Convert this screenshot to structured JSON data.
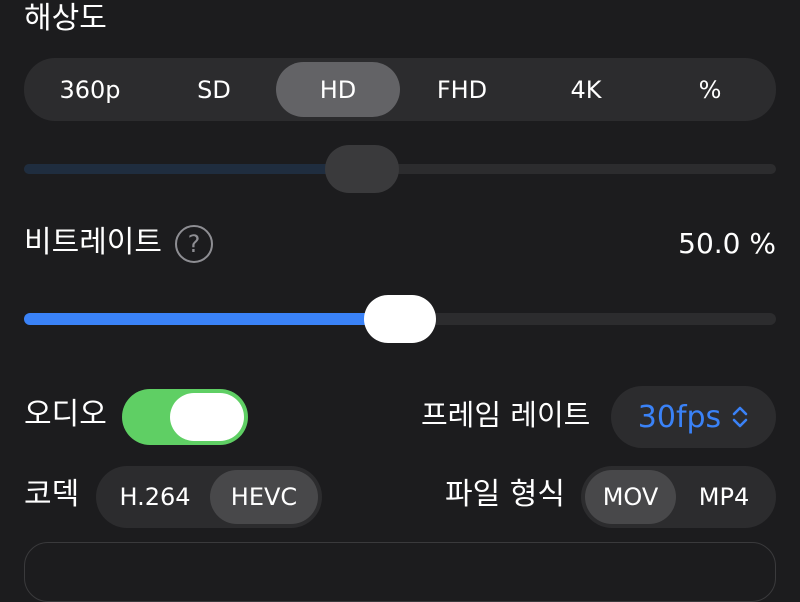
{
  "resolution": {
    "title": "해상도",
    "options": [
      "360p",
      "SD",
      "HD",
      "FHD",
      "4K",
      "%"
    ],
    "selected": "HD",
    "slider_level": 0.45
  },
  "bitrate": {
    "title": "비트레이트",
    "help_glyph": "?",
    "value_text": "50.0 %",
    "level": 0.5
  },
  "audio": {
    "label": "오디오",
    "enabled": true
  },
  "frame_rate": {
    "label": "프레임 레이트",
    "value": "30fps"
  },
  "codec": {
    "label": "코덱",
    "options": [
      "H.264",
      "HEVC"
    ],
    "selected": "HEVC"
  },
  "file_format": {
    "label": "파일 형식",
    "options": [
      "MOV",
      "MP4"
    ],
    "selected": "MOV"
  },
  "colors": {
    "accent": "#3a82f7",
    "toggle_on": "#5fcf64",
    "background": "#1c1c1e",
    "control_bg": "#2c2c2e"
  },
  "icons": {
    "help": "question-circle-icon",
    "stepper": "chevron-up-down-icon"
  }
}
